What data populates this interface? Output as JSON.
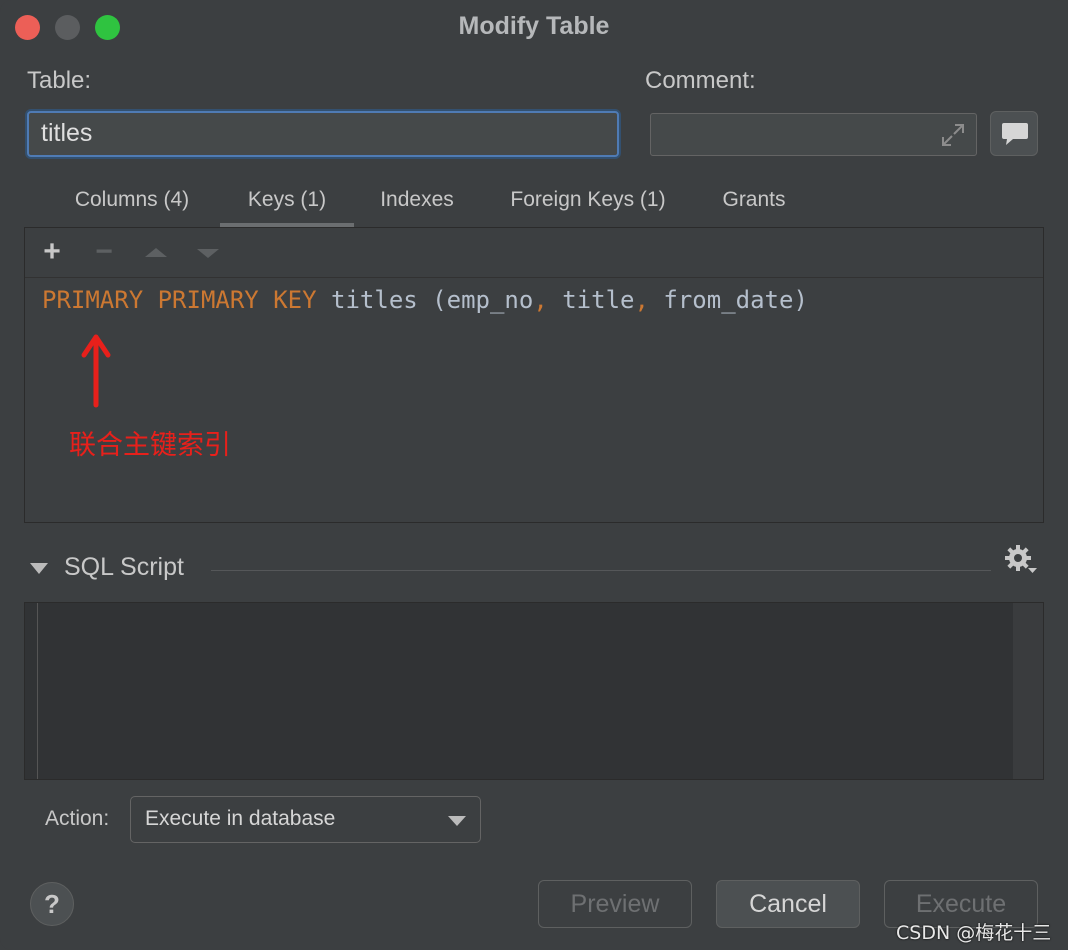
{
  "window": {
    "title": "Modify Table"
  },
  "table": {
    "label": "Table:",
    "value": "titles"
  },
  "comment": {
    "label": "Comment:",
    "value": ""
  },
  "tabs": [
    {
      "label": "Columns (4)",
      "active": false
    },
    {
      "label": "Keys (1)",
      "active": true
    },
    {
      "label": "Indexes",
      "active": false
    },
    {
      "label": "Foreign Keys (1)",
      "active": false
    },
    {
      "label": "Grants",
      "active": false
    }
  ],
  "keys": {
    "toolbar": {
      "add": "+",
      "remove": "−"
    },
    "definition": {
      "name": "PRIMARY",
      "keyword": "PRIMARY KEY",
      "table": "titles",
      "columns": [
        "emp_no",
        "title",
        "from_date"
      ]
    },
    "annotation": "联合主键索引",
    "annotation_color": "#e8201b"
  },
  "sql_script": {
    "title": "SQL Script",
    "content": ""
  },
  "action": {
    "label": "Action:",
    "selected": "Execute in database"
  },
  "buttons": {
    "help": "?",
    "preview": "Preview",
    "cancel": "Cancel",
    "execute": "Execute"
  },
  "watermark": "CSDN @梅花十三",
  "colors": {
    "keyword": "#cc7832",
    "identifier": "#b5bfcc",
    "focus_border": "#4f7bb4",
    "close": "#ec5f57",
    "maximize": "#2fc340"
  }
}
